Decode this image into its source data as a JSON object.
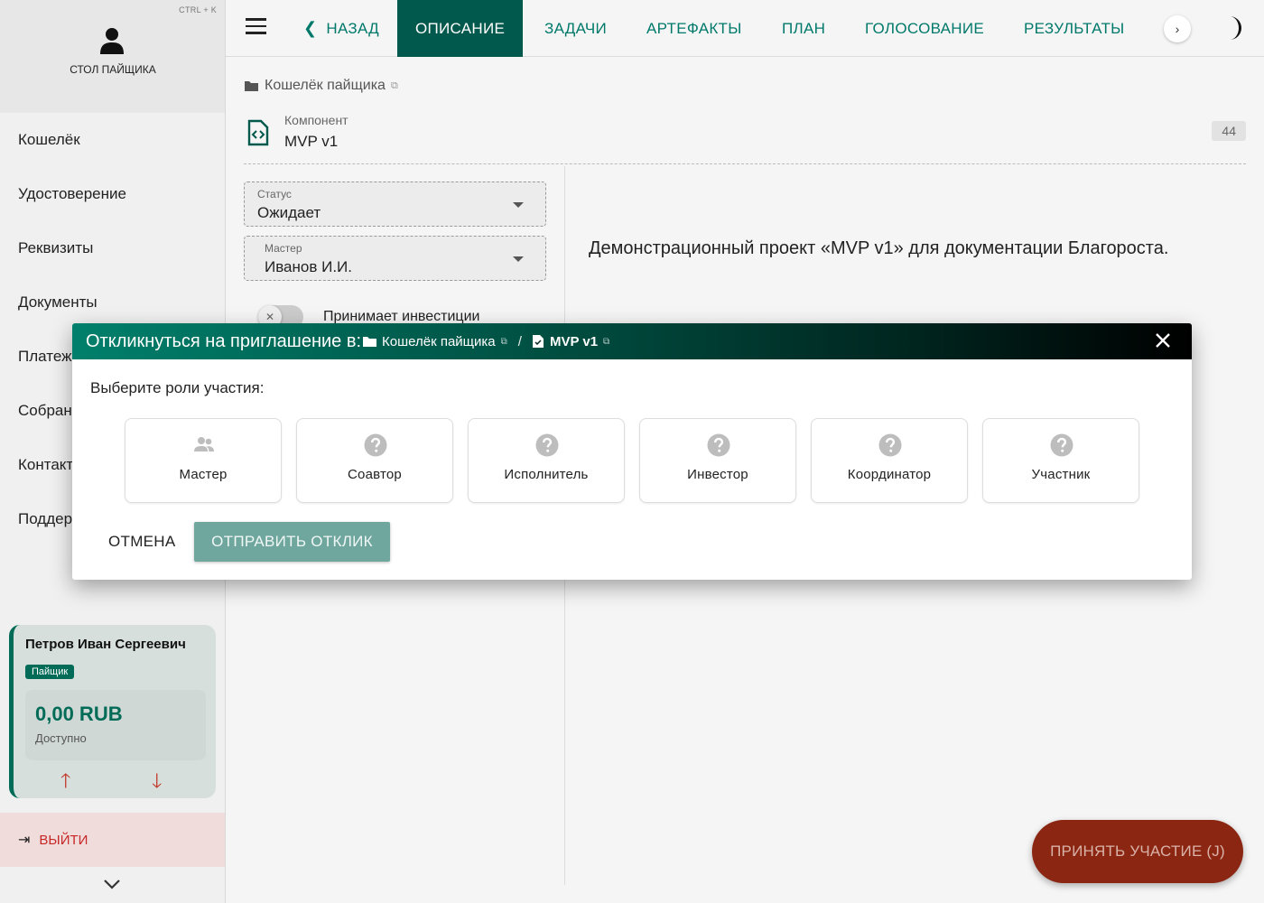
{
  "sidebar": {
    "shortcut": "CTRL + K",
    "desk_label": "СТОЛ ПАЙЩИКА",
    "items": [
      {
        "label": "Кошелёк"
      },
      {
        "label": "Удостоверение"
      },
      {
        "label": "Реквизиты"
      },
      {
        "label": "Документы"
      },
      {
        "label": "Платеж"
      },
      {
        "label": "Собран"
      },
      {
        "label": "Контакт"
      },
      {
        "label": "Поддер"
      }
    ],
    "user": {
      "name": "Петров Иван Сергеевич",
      "role": "Пайщик",
      "amount": "0,00 RUB",
      "available": "Доступно"
    },
    "logout": "ВЫЙТИ"
  },
  "topbar": {
    "back": "НАЗАД",
    "tabs": [
      "ОПИСАНИЕ",
      "ЗАДАЧИ",
      "АРТЕФАКТЫ",
      "ПЛАН",
      "ГОЛОСОВАНИЕ",
      "РЕЗУЛЬТАТЫ"
    ],
    "more": "›"
  },
  "main": {
    "breadcrumb": "Кошелёк пайщика",
    "component_type": "Компонент",
    "component_name": "MVP v1",
    "count": "44",
    "status_label": "Статус",
    "status_value": "Ожидает",
    "master_label": "Мастер",
    "master_value": "Иванов И.И.",
    "toggle_label": "Принимает инвестиции",
    "description": "Демонстрационный проект «MVP v1» для документации Благороста.",
    "fab": "ПРИНЯТЬ УЧАСТИЕ (J)"
  },
  "dialog": {
    "title": "Откликнуться на приглашение в:",
    "crumb_project": "Кошелёк пайщика",
    "crumb_sep": "/",
    "crumb_component": "MVP v1",
    "prompt": "Выберите роли участия:",
    "roles": [
      {
        "label": "Мастер",
        "icon": "people-icon"
      },
      {
        "label": "Соавтор",
        "icon": "question-icon"
      },
      {
        "label": "Исполнитель",
        "icon": "question-icon"
      },
      {
        "label": "Инвестор",
        "icon": "question-icon"
      },
      {
        "label": "Координатор",
        "icon": "question-icon"
      },
      {
        "label": "Участник",
        "icon": "question-icon"
      }
    ],
    "cancel": "ОТМЕНА",
    "submit": "ОТПРАВИТЬ ОТКЛИК"
  },
  "colors": {
    "accent": "#00796b",
    "active_tab": "#00594c",
    "fab": "#8b2612",
    "submit": "#6fa79e"
  }
}
